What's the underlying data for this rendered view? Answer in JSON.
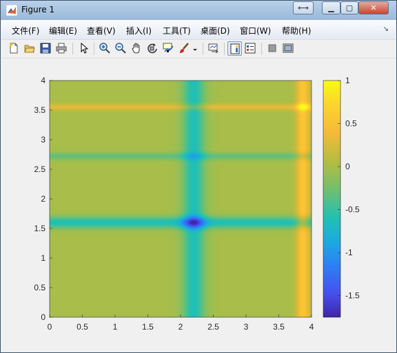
{
  "window": {
    "title": "Figure 1"
  },
  "menu": [
    "文件(F)",
    "编辑(E)",
    "查看(V)",
    "插入(I)",
    "工具(T)",
    "桌面(D)",
    "窗口(W)",
    "帮助(H)"
  ],
  "toolbar": [
    "new-figure-icon",
    "open-file-icon",
    "save-icon",
    "print-icon",
    "select-arrow-icon",
    "zoom-in-icon",
    "zoom-out-icon",
    "pan-hand-icon",
    "rotate-3d-icon",
    "data-cursor-icon",
    "brush-icon",
    "brush-dropdown-icon",
    "link-plot-icon",
    "colorbar-icon",
    "legend-icon",
    "hide-tools-icon",
    "show-tools-icon"
  ],
  "chart_data": {
    "type": "heatmap",
    "x_ticks": [
      "0",
      "0.5",
      "1",
      "1.5",
      "2",
      "2.5",
      "3",
      "3.5",
      "4"
    ],
    "y_ticks": [
      "0",
      "0.5",
      "1",
      "1.5",
      "2",
      "2.5",
      "3",
      "3.5",
      "4"
    ],
    "xlim": [
      0,
      4
    ],
    "ylim": [
      0,
      4
    ],
    "colorbar": {
      "ticks": [
        "1",
        "0.5",
        "0",
        "-0.5",
        "-1",
        "-1.5"
      ],
      "range": [
        -1.75,
        1
      ]
    },
    "colormap": "parula",
    "features": {
      "blue_vertical_band_x": 2.2,
      "yellow_vertical_band_x": 3.87,
      "blue_horizontal_band_y": 1.6,
      "cyan_horizontal_band_y": 2.72,
      "orange_horizontal_band_y": 3.55,
      "minimum_value_at": [
        2.2,
        1.6
      ],
      "maximum_value_at": [
        3.87,
        3.55
      ]
    }
  }
}
